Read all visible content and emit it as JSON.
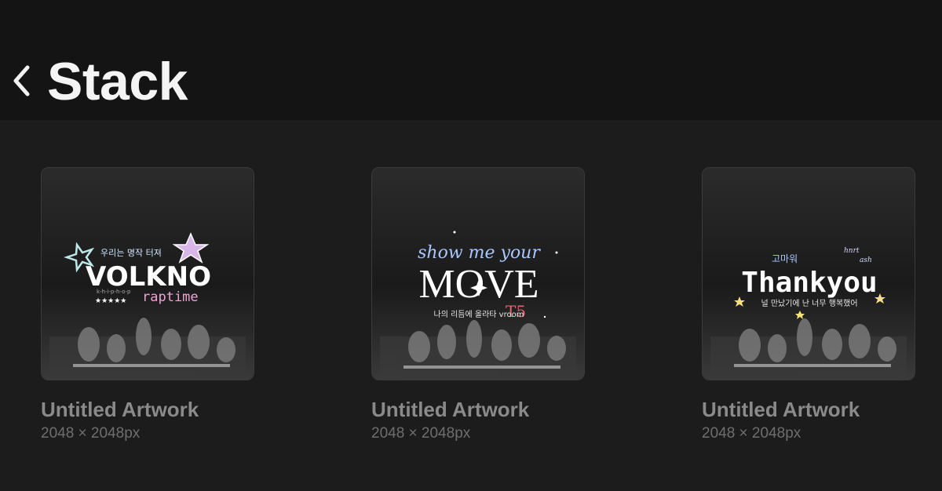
{
  "header": {
    "title": "Stack",
    "back_icon": "chevron-left-icon"
  },
  "artworks": [
    {
      "name": "Untitled Artwork",
      "size": "2048 × 2048px",
      "texts": {
        "top": "우리는 명작  터져",
        "main": "VOLKNO",
        "sub": "raptime",
        "small": "k-h-i-p-h-o-p",
        "stars": "★★★★★"
      }
    },
    {
      "name": "Untitled Artwork",
      "size": "2048 × 2048px",
      "texts": {
        "top": "show me your",
        "main": "MOVE",
        "tag": "T5",
        "bottom": "나의 리듬에 올라타 vroom"
      }
    },
    {
      "name": "Untitled Artwork",
      "size": "2048 × 2048px",
      "texts": {
        "top": "고마워",
        "corner": "hnrt",
        "corner2": "ash",
        "main": "Thankyou",
        "bottom": "널 만났기에 난 너무 행복했어"
      }
    }
  ],
  "colors": {
    "header_bg": "#141414",
    "page_bg": "#1c1c1c",
    "accent_blue": "#a9c8ff",
    "accent_pink": "#f0a3d4",
    "accent_yellow": "#f5e27a"
  }
}
